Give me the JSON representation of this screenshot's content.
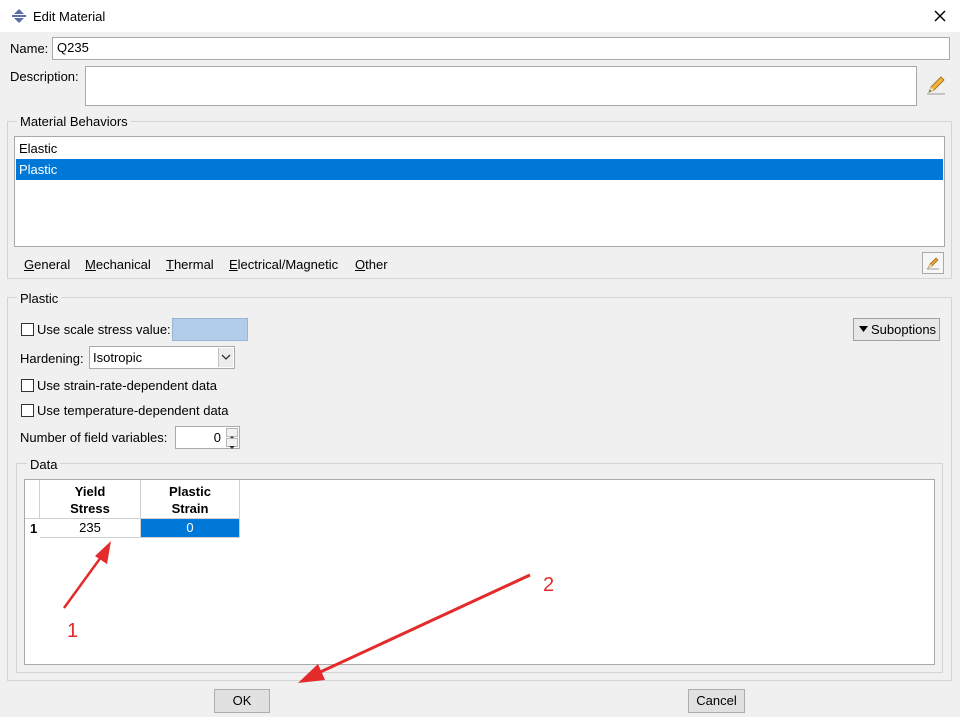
{
  "window": {
    "title": "Edit Material"
  },
  "name_field": {
    "label": "Name:",
    "value": "Q235"
  },
  "description": {
    "label": "Description:",
    "value": ""
  },
  "material_behaviors": {
    "title": "Material Behaviors",
    "items": [
      {
        "label": "Elastic",
        "selected": false
      },
      {
        "label": "Plastic",
        "selected": true
      }
    ]
  },
  "menu": [
    {
      "label": "General",
      "mnemonic": "G",
      "rest": "eneral"
    },
    {
      "label": "Mechanical",
      "mnemonic": "M",
      "rest": "echanical"
    },
    {
      "label": "Thermal",
      "mnemonic": "T",
      "rest": "hermal"
    },
    {
      "label": "Electrical/Magnetic",
      "mnemonic": "E",
      "rest": "lectrical/Magnetic"
    },
    {
      "label": "Other",
      "mnemonic": "O",
      "rest": "ther"
    }
  ],
  "plastic": {
    "title": "Plastic",
    "scale_stress_label": "Use scale stress value:",
    "hardening_label": "Hardening:",
    "hardening_value": "Isotropic",
    "strain_rate_label": "Use strain-rate-dependent data",
    "temperature_label": "Use temperature-dependent data",
    "field_vars_label": "Number of field variables:",
    "field_vars_value": "0",
    "suboptions_label": "Suboptions"
  },
  "data": {
    "title": "Data",
    "columns": [
      {
        "line1": "Yield",
        "line2": "Stress"
      },
      {
        "line1": "Plastic",
        "line2": "Strain"
      }
    ],
    "rows": [
      {
        "index": "1",
        "cells": [
          "235",
          "0"
        ]
      }
    ]
  },
  "buttons": {
    "ok": "OK",
    "cancel": "Cancel"
  },
  "annotations": {
    "arrow1": "1",
    "arrow2": "2"
  },
  "colors": {
    "selection": "#0078d7",
    "annotation": "#e32b2b",
    "disabled_field": "#b2cdea"
  }
}
